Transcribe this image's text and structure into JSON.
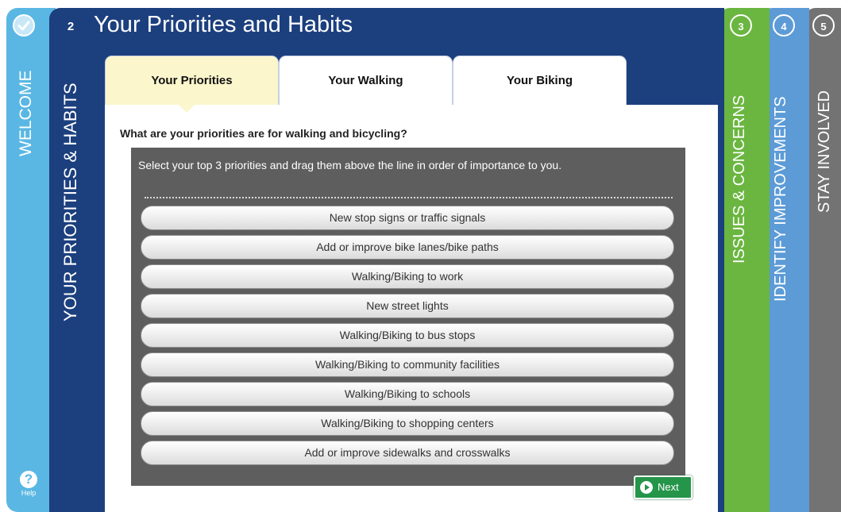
{
  "welcome": {
    "step_icon": "check-icon",
    "label": "WELCOME",
    "help_icon": "question-icon",
    "help_label": "Help"
  },
  "active_step": {
    "number": "2",
    "title": "Your Priorities and Habits",
    "side_label": "YOUR PRIORITIES & HABITS",
    "tabs": [
      {
        "label": "Your Priorities",
        "selected": true
      },
      {
        "label": "Your Walking",
        "selected": false
      },
      {
        "label": "Your Biking",
        "selected": false
      }
    ],
    "question": "What are your priorities are for walking and bicycling?",
    "instruction": "Select your top 3 priorities and drag them above the line in order of importance to you.",
    "priorities": [
      "New stop signs or traffic signals",
      "Add or improve bike lanes/bike paths",
      "Walking/Biking to work",
      "New street lights",
      "Walking/Biking to bus stops",
      "Walking/Biking to community facilities",
      "Walking/Biking to schools",
      "Walking/Biking to shopping centers",
      "Add or improve sidewalks and crosswalks"
    ],
    "next_label": "Next",
    "next_icon": "arrow-right-circle-icon"
  },
  "steps": {
    "issues": {
      "number": "3",
      "label": "ISSUES & CONCERNS"
    },
    "identify": {
      "number": "4",
      "label": "IDENTIFY IMPROVEMENTS"
    },
    "stay": {
      "number": "5",
      "label": "STAY INVOLVED"
    }
  },
  "colors": {
    "welcome": "#5ab7e3",
    "active": "#1c3f7e",
    "issues": "#6ab640",
    "identify": "#5c9bd6",
    "stay": "#737373",
    "selected_tab": "#fbf6cc",
    "drag_area": "#5e5e5e",
    "next_button": "#25954a"
  }
}
